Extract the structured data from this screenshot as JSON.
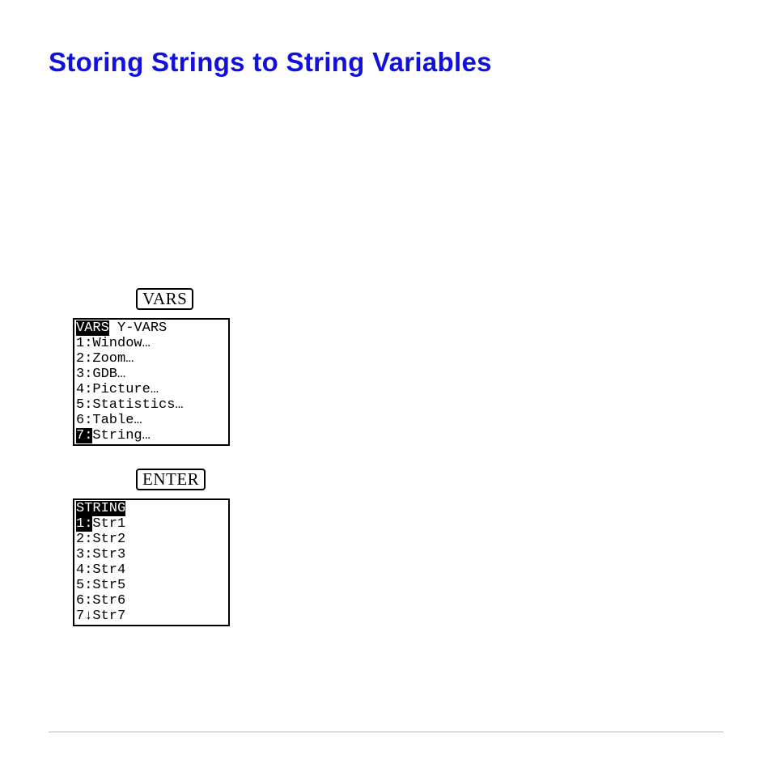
{
  "title": "Storing Strings to String Variables",
  "keys": {
    "vars": "VARS",
    "enter": "ENTER"
  },
  "screen1": {
    "tab_selected": "VARS",
    "tab_other": " Y-VARS",
    "items": [
      "1:Window…",
      "2:Zoom…",
      "3:GDB…",
      "4:Picture…",
      "5:Statistics…",
      "6:Table…"
    ],
    "highlight_prefix": "7:",
    "highlight_rest": "String…"
  },
  "screen2": {
    "header": "STRING",
    "first_prefix": "1:",
    "first_rest": "Str1",
    "items": [
      "2:Str2",
      "3:Str3",
      "4:Str4",
      "5:Str5",
      "6:Str6",
      "7↓Str7"
    ]
  }
}
